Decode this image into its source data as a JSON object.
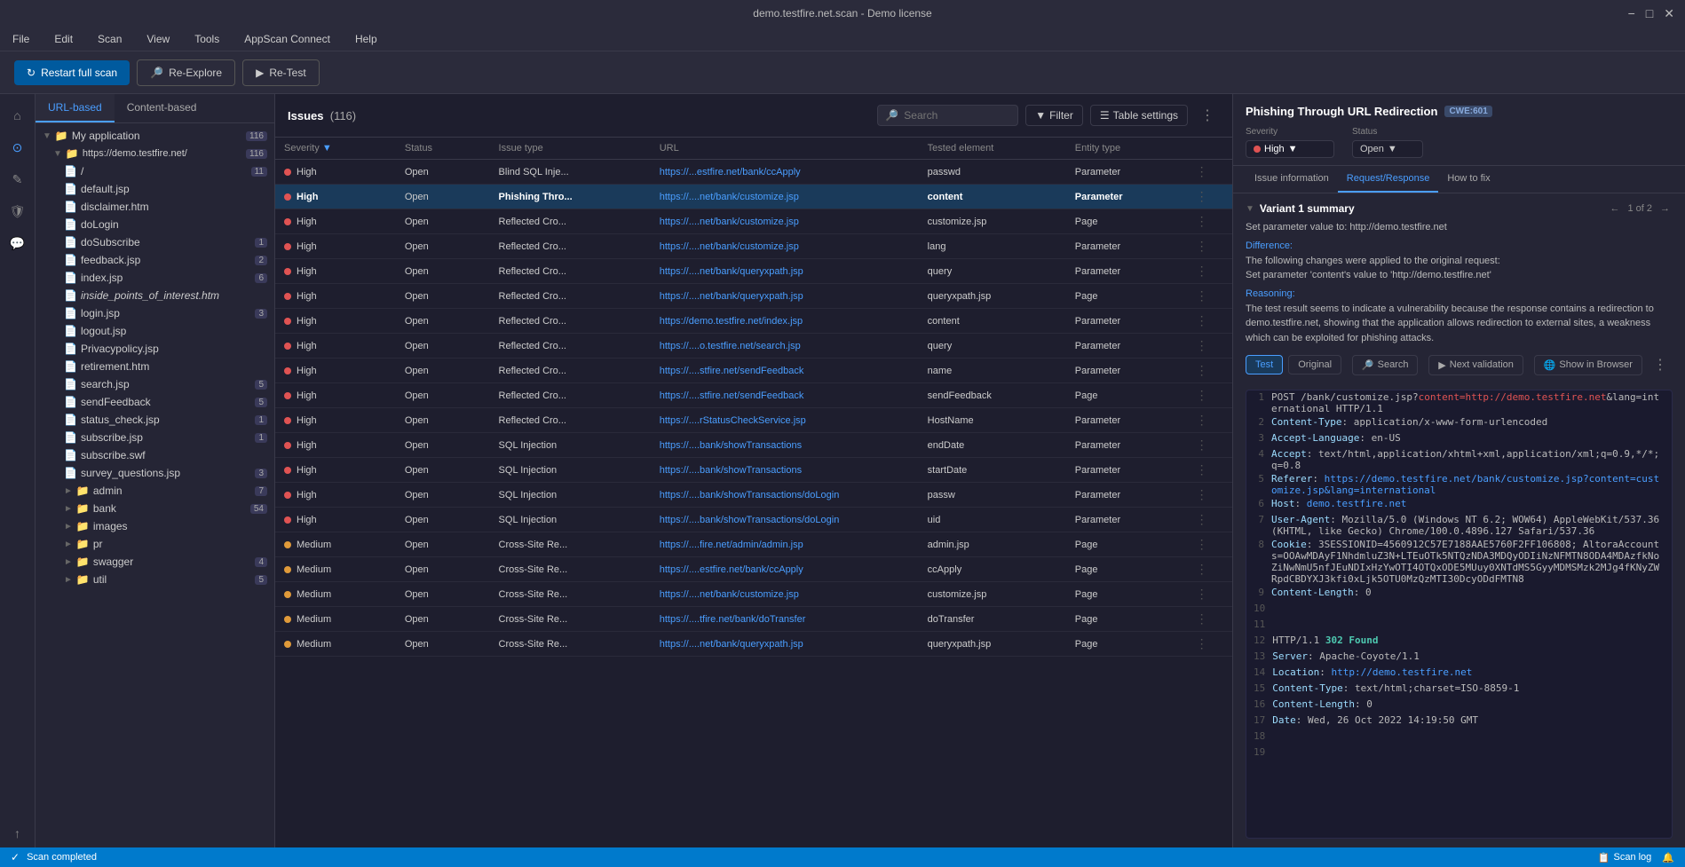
{
  "app": {
    "title": "demo.testfire.net.scan - Demo license",
    "window_controls": [
      "minimize",
      "maximize",
      "close"
    ]
  },
  "menubar": {
    "items": [
      "File",
      "Edit",
      "Scan",
      "View",
      "Tools",
      "AppScan Connect",
      "Help"
    ]
  },
  "toolbar": {
    "restart_label": "Restart full scan",
    "reexplore_label": "Re-Explore",
    "retest_label": "Re-Test"
  },
  "sidebar_icons": [
    {
      "name": "home-icon",
      "symbol": "⌂"
    },
    {
      "name": "scan-icon",
      "symbol": "⊙"
    },
    {
      "name": "pencil-icon",
      "symbol": "✎"
    },
    {
      "name": "shield-icon",
      "symbol": "🛡"
    },
    {
      "name": "chat-icon",
      "symbol": "💬"
    },
    {
      "name": "help-icon",
      "symbol": "?"
    },
    {
      "name": "arrow-icon",
      "symbol": "↑"
    }
  ],
  "filetree": {
    "tabs": [
      "URL-based",
      "Content-based"
    ],
    "active_tab": "URL-based",
    "root": {
      "label": "My application",
      "count": 116,
      "children": [
        {
          "label": "https://demo.testfire.net/",
          "count": 116,
          "children": [
            {
              "label": "/",
              "count": 11,
              "children": []
            },
            {
              "label": "default.jsp",
              "count": null,
              "children": []
            },
            {
              "label": "disclaimer.htm",
              "count": null,
              "children": []
            },
            {
              "label": "doLogin",
              "count": null,
              "children": []
            },
            {
              "label": "doSubscribe",
              "count": 1,
              "children": []
            },
            {
              "label": "feedback.jsp",
              "count": 2,
              "children": []
            },
            {
              "label": "index.jsp",
              "count": 6,
              "children": []
            },
            {
              "label": "inside_points_of_interest.htm",
              "count": null,
              "children": []
            },
            {
              "label": "login.jsp",
              "count": 3,
              "children": []
            },
            {
              "label": "logout.jsp",
              "count": null,
              "children": []
            },
            {
              "label": "Privacypolicy.jsp",
              "count": null,
              "children": []
            },
            {
              "label": "retirement.htm",
              "count": null,
              "children": []
            },
            {
              "label": "search.jsp",
              "count": 5,
              "children": []
            },
            {
              "label": "sendFeedback",
              "count": 5,
              "children": []
            },
            {
              "label": "status_check.jsp",
              "count": 1,
              "children": []
            },
            {
              "label": "subscribe.jsp",
              "count": 1,
              "children": []
            },
            {
              "label": "subscribe.swf",
              "count": null,
              "children": []
            },
            {
              "label": "survey_questions.jsp",
              "count": 3,
              "children": []
            },
            {
              "label": "admin",
              "count": 7,
              "folder": true
            },
            {
              "label": "bank",
              "count": 54,
              "folder": true
            },
            {
              "label": "images",
              "count": null,
              "folder": true
            },
            {
              "label": "pr",
              "count": null,
              "folder": true
            },
            {
              "label": "swagger",
              "count": 4,
              "folder": true
            },
            {
              "label": "util",
              "count": 5,
              "folder": true
            }
          ]
        }
      ]
    }
  },
  "issues": {
    "title": "Issues",
    "count": 116,
    "search_placeholder": "Search",
    "filter_label": "Filter",
    "table_settings_label": "Table settings",
    "columns": [
      "Severity",
      "Status",
      "Issue type",
      "URL",
      "Tested element",
      "Entity type"
    ],
    "rows": [
      {
        "severity": "High",
        "severity_type": "high",
        "status": "Open",
        "issue_type": "Blind SQL Inje...",
        "url": "https://...estfire.net/bank/ccApply",
        "tested": "passwd",
        "entity": "Parameter",
        "selected": false
      },
      {
        "severity": "High",
        "severity_type": "high",
        "status": "Open",
        "issue_type": "Phishing Thro...",
        "url": "https://....net/bank/customize.jsp",
        "tested": "content",
        "entity": "Parameter",
        "selected": true,
        "bold": true
      },
      {
        "severity": "High",
        "severity_type": "high",
        "status": "Open",
        "issue_type": "Reflected Cro...",
        "url": "https://....net/bank/customize.jsp",
        "tested": "customize.jsp",
        "entity": "Page",
        "selected": false
      },
      {
        "severity": "High",
        "severity_type": "high",
        "status": "Open",
        "issue_type": "Reflected Cro...",
        "url": "https://....net/bank/customize.jsp",
        "tested": "lang",
        "entity": "Parameter",
        "selected": false
      },
      {
        "severity": "High",
        "severity_type": "high",
        "status": "Open",
        "issue_type": "Reflected Cro...",
        "url": "https://....net/bank/queryxpath.jsp",
        "tested": "query",
        "entity": "Parameter",
        "selected": false
      },
      {
        "severity": "High",
        "severity_type": "high",
        "status": "Open",
        "issue_type": "Reflected Cro...",
        "url": "https://....net/bank/queryxpath.jsp",
        "tested": "queryxpath.jsp",
        "entity": "Page",
        "selected": false
      },
      {
        "severity": "High",
        "severity_type": "high",
        "status": "Open",
        "issue_type": "Reflected Cro...",
        "url": "https://demo.testfire.net/index.jsp",
        "tested": "content",
        "entity": "Parameter",
        "selected": false
      },
      {
        "severity": "High",
        "severity_type": "high",
        "status": "Open",
        "issue_type": "Reflected Cro...",
        "url": "https://....o.testfire.net/search.jsp",
        "tested": "query",
        "entity": "Parameter",
        "selected": false
      },
      {
        "severity": "High",
        "severity_type": "high",
        "status": "Open",
        "issue_type": "Reflected Cro...",
        "url": "https://....stfire.net/sendFeedback",
        "tested": "name",
        "entity": "Parameter",
        "selected": false
      },
      {
        "severity": "High",
        "severity_type": "high",
        "status": "Open",
        "issue_type": "Reflected Cro...",
        "url": "https://....stfire.net/sendFeedback",
        "tested": "sendFeedback",
        "entity": "Page",
        "selected": false
      },
      {
        "severity": "High",
        "severity_type": "high",
        "status": "Open",
        "issue_type": "Reflected Cro...",
        "url": "https://....rStatusCheckService.jsp",
        "tested": "HostName",
        "entity": "Parameter",
        "selected": false
      },
      {
        "severity": "High",
        "severity_type": "high",
        "status": "Open",
        "issue_type": "SQL Injection",
        "url": "https://....bank/showTransactions",
        "tested": "endDate",
        "entity": "Parameter",
        "selected": false
      },
      {
        "severity": "High",
        "severity_type": "high",
        "status": "Open",
        "issue_type": "SQL Injection",
        "url": "https://....bank/showTransactions",
        "tested": "startDate",
        "entity": "Parameter",
        "selected": false
      },
      {
        "severity": "High",
        "severity_type": "high",
        "status": "Open",
        "issue_type": "SQL Injection",
        "url": "https://....bank/showTransactions/doLogin",
        "tested": "passw",
        "entity": "Parameter",
        "selected": false
      },
      {
        "severity": "High",
        "severity_type": "high",
        "status": "Open",
        "issue_type": "SQL Injection",
        "url": "https://....bank/showTransactions/doLogin",
        "tested": "uid",
        "entity": "Parameter",
        "selected": false
      },
      {
        "severity": "Medium",
        "severity_type": "medium",
        "status": "Open",
        "issue_type": "Cross-Site Re...",
        "url": "https://....fire.net/admin/admin.jsp",
        "tested": "admin.jsp",
        "entity": "Page",
        "selected": false
      },
      {
        "severity": "Medium",
        "severity_type": "medium",
        "status": "Open",
        "issue_type": "Cross-Site Re...",
        "url": "https://....estfire.net/bank/ccApply",
        "tested": "ccApply",
        "entity": "Page",
        "selected": false
      },
      {
        "severity": "Medium",
        "severity_type": "medium",
        "status": "Open",
        "issue_type": "Cross-Site Re...",
        "url": "https://....net/bank/customize.jsp",
        "tested": "customize.jsp",
        "entity": "Page",
        "selected": false
      },
      {
        "severity": "Medium",
        "severity_type": "medium",
        "status": "Open",
        "issue_type": "Cross-Site Re...",
        "url": "https://....tfire.net/bank/doTransfer",
        "tested": "doTransfer",
        "entity": "Page",
        "selected": false
      },
      {
        "severity": "Medium",
        "severity_type": "medium",
        "status": "Open",
        "issue_type": "Cross-Site Re...",
        "url": "https://....net/bank/queryxpath.jsp",
        "tested": "queryxpath.jsp",
        "entity": "Page",
        "selected": false
      }
    ]
  },
  "detail": {
    "title": "Phishing Through URL Redirection",
    "cwe": "CWE:601",
    "severity_label": "Severity",
    "severity_value": "High",
    "status_label": "Status",
    "status_value": "Open",
    "tabs": [
      "Issue information",
      "Request/Response",
      "How to fix"
    ],
    "active_tab": "Request/Response",
    "variant_title": "Variant 1 summary",
    "variant_nav": "1 of 2",
    "variant_collapsed": false,
    "set_param_text": "Set parameter value to: http://demo.testfire.net",
    "difference_label": "Difference:",
    "difference_text": "The following changes were applied to the original request:\nSet parameter 'content's value to 'http://demo.testfire.net'",
    "reasoning_label": "Reasoning:",
    "reasoning_text": "The test result seems to indicate a vulnerability because the response contains a redirection to demo.testfire.net, showing that the application allows redirection to external sites, a weakness which can be exploited for phishing attacks.",
    "code_tabs": [
      "Test",
      "Original"
    ],
    "active_code_tab": "Test",
    "search_btn_label": "Search",
    "next_validation_label": "Next validation",
    "show_browser_label": "Show in Browser",
    "code_lines": [
      {
        "num": 1,
        "content": "POST /bank/customize.jsp?",
        "highlight": "content=http://demo.testfire.net",
        "rest": "&lang=international HTTP/1.1"
      },
      {
        "num": 2,
        "content": "Content-Type: application/x-www-form-urlencoded",
        "parts": [
          {
            "type": "key",
            "text": "Content-Type"
          },
          {
            "type": "plain",
            "text": ": application/x-www-form-urlencoded"
          }
        ]
      },
      {
        "num": 3,
        "content": "Accept-Language: en-US",
        "parts": [
          {
            "type": "key",
            "text": "Accept-Language"
          },
          {
            "type": "plain",
            "text": ": en-US"
          }
        ]
      },
      {
        "num": 4,
        "content": "Accept: text/html,application/xhtml+xml,application/xml;q=0.9,*/*;q=0.8",
        "parts": [
          {
            "type": "key",
            "text": "Accept"
          },
          {
            "type": "plain",
            "text": ": text/html,application/xhtml+xml,application/xml;q=0.9,*/*;q=0.8"
          }
        ]
      },
      {
        "num": 5,
        "content": "Referer: https://demo.testfire.net/bank/customize.jsp?content=customize.jsp&lang=international",
        "parts": [
          {
            "type": "key",
            "text": "Referer"
          },
          {
            "type": "plain",
            "text": ": "
          },
          {
            "type": "url",
            "text": "https://demo.testfire.net/bank/customize.jsp?content=customize.jsp&lang=international"
          }
        ]
      },
      {
        "num": 6,
        "content": "Host: demo.testfire.net",
        "parts": [
          {
            "type": "key",
            "text": "Host"
          },
          {
            "type": "plain",
            "text": ": "
          },
          {
            "type": "url",
            "text": "demo.testfire.net"
          }
        ]
      },
      {
        "num": 7,
        "content": "User-Agent: Mozilla/5.0 (Windows NT 6.2; WOW64) AppleWebKit/537.36 (KHTML, like Gecko) Chrome/100.0.4896.127 Safari/537.36",
        "parts": [
          {
            "type": "key",
            "text": "User-Agent"
          },
          {
            "type": "plain",
            "text": ": Mozilla/5.0 (Windows NT 6.2; WOW64) AppleWebKit/537.36 (KHTML, like Gecko) Chrome/100.0.4896.127 Safari/537.36"
          }
        ]
      },
      {
        "num": 8,
        "content": "Cookie: 3SESSIONID=4560912C57E7188AAE5760F2FF106808; AltoraAccounts=OOAwMDAyF1NhdmluZ3N+LTEuOTk5NTQzNDA3MDQyODIiNzNFMTN8ODA4MDAzfkNoZiNwNmU5nfJEuNDIxHzYwOTI4OTQxODE5MUuy0XNT MS5GyyMDMSMzk2MJg4fKNyZWRpdCBDYXJ3kfi0xLjk5OTU0MzQzMTI30DcyODdFMTN8",
        "parts": [
          {
            "type": "key",
            "text": "Cookie"
          },
          {
            "type": "plain",
            "text": ": 3SESSIONID=4560912C57E7188AAE5760F2FF106808; AltoraAccounts=OOAwMDAyF1NhdmluZ3N+LTEuOTk5NTQzNDA3MDQyODIiNzNFMTN8ODA4MDAzfkNoZiNwNmU5nfJEuNDIxHzYwOTI4OTQxODE5MUuy0XNTdMS5GyyMDMSMzk2MJg4fKNyZWRpdCBDYXJ3kfi0xLjk5OTU0MzQzMTI30DcyODdFMTN8"
          }
        ]
      },
      {
        "num": 9,
        "content": "Content-Length: 0",
        "parts": [
          {
            "type": "key",
            "text": "Content-Length"
          },
          {
            "type": "plain",
            "text": ": 0"
          }
        ]
      },
      {
        "num": 10,
        "content": ""
      },
      {
        "num": 11,
        "content": ""
      },
      {
        "num": 12,
        "content": "HTTP/1.1 302 Found",
        "parts": [
          {
            "type": "plain",
            "text": "HTTP/1.1 "
          },
          {
            "type": "found",
            "text": "302 Found"
          }
        ]
      },
      {
        "num": 13,
        "content": "Server: Apache-Coyote/1.1",
        "parts": [
          {
            "type": "key",
            "text": "Server"
          },
          {
            "type": "plain",
            "text": ": Apache-Coyote/1.1"
          }
        ]
      },
      {
        "num": 14,
        "content": "Location: http://demo.testfire.net",
        "parts": [
          {
            "type": "key",
            "text": "Location"
          },
          {
            "type": "plain",
            "text": ": "
          },
          {
            "type": "url",
            "text": "http://demo.testfire.net"
          }
        ]
      },
      {
        "num": 15,
        "content": "Content-Type: text/html;charset=ISO-8859-1",
        "parts": [
          {
            "type": "key",
            "text": "Content-Type"
          },
          {
            "type": "plain",
            "text": ": text/html;charset=ISO-8859-1"
          }
        ]
      },
      {
        "num": 16,
        "content": "Content-Length: 0",
        "parts": [
          {
            "type": "key",
            "text": "Content-Length"
          },
          {
            "type": "plain",
            "text": ": 0"
          }
        ]
      },
      {
        "num": 17,
        "content": "Date: Wed, 26 Oct 2022 14:19:50 GMT",
        "parts": [
          {
            "type": "key",
            "text": "Date"
          },
          {
            "type": "plain",
            "text": ": Wed, 26 Oct 2022 14:19:50 GMT"
          }
        ]
      },
      {
        "num": 18,
        "content": ""
      },
      {
        "num": 19,
        "content": ""
      }
    ]
  },
  "statusbar": {
    "scan_completed": "Scan completed",
    "scan_log_label": "Scan log",
    "notifications_label": "Notifications"
  }
}
